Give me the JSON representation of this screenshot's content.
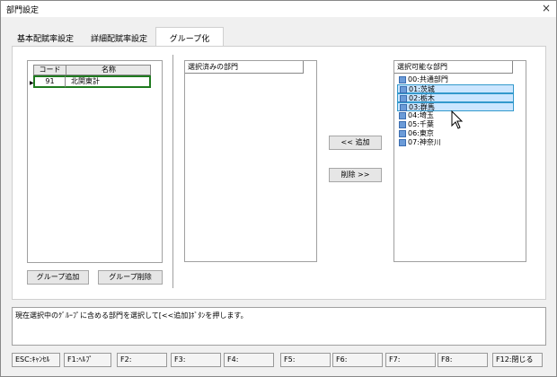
{
  "window": {
    "title": "部門設定",
    "close_label": "×"
  },
  "tabs": [
    {
      "label": "基本配賦率設定"
    },
    {
      "label": "詳細配賦率設定"
    },
    {
      "label": "グループ化"
    }
  ],
  "group_grid": {
    "columns": [
      "コード",
      "名称"
    ],
    "rows": [
      {
        "code": "91",
        "name": "北関東計"
      }
    ],
    "row_marker": "▶"
  },
  "buttons": {
    "add_group": "グループ追加",
    "delete_group": "グループ削除",
    "add": "<< 追加",
    "remove": "削除 >>"
  },
  "selected_list": {
    "header": "選択済みの部門"
  },
  "available_list": {
    "header": "選択可能な部門",
    "items": [
      {
        "label": "00:共通部門",
        "selected": false
      },
      {
        "label": "01:茨城",
        "selected": true
      },
      {
        "label": "02:栃木",
        "selected": true
      },
      {
        "label": "03:群馬",
        "selected": true
      },
      {
        "label": "04:埼玉",
        "selected": false
      },
      {
        "label": "05:千葉",
        "selected": false
      },
      {
        "label": "06:東京",
        "selected": false
      },
      {
        "label": "07:神奈川",
        "selected": false
      }
    ]
  },
  "status_message": "現在選択中のｸﾞﾙｰﾌﾟに含める部門を選択して[<<追加]ﾎﾞﾀﾝを押します。",
  "function_keys": [
    {
      "label": "ESC:ｷｬﾝｾﾙ"
    },
    {
      "label": "F1:ﾍﾙﾌﾟ"
    },
    {
      "label": "F2:"
    },
    {
      "label": "F3:"
    },
    {
      "label": "F4:"
    },
    {
      "label": "F5:"
    },
    {
      "label": "F6:"
    },
    {
      "label": "F7:"
    },
    {
      "label": "F8:"
    },
    {
      "label": "F12:閉じる"
    }
  ]
}
